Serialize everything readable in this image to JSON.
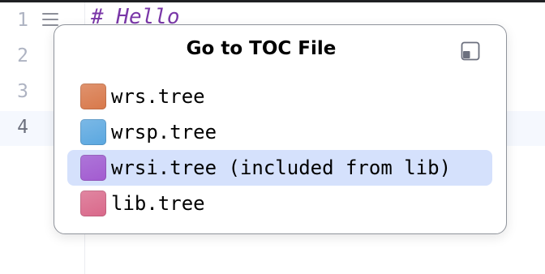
{
  "editor": {
    "line_numbers": [
      "1",
      "2",
      "3",
      "4"
    ],
    "code_line_1": "# Hello"
  },
  "popup": {
    "title": "Go to TOC File",
    "items": [
      {
        "label": "wrs.tree",
        "icon_color": "#d8784a",
        "selected": false
      },
      {
        "label": "wrsp.tree",
        "icon_color": "#5aa7e0",
        "selected": false
      },
      {
        "label": "wrsi.tree (included from lib)",
        "icon_color": "#a35bd0",
        "selected": true
      },
      {
        "label": "lib.tree",
        "icon_color": "#d9688a",
        "selected": false
      }
    ]
  },
  "colors": {
    "selection": "#d5e1fc",
    "code_comment": "#7a37a8",
    "line_number": "#aeb3c2"
  }
}
